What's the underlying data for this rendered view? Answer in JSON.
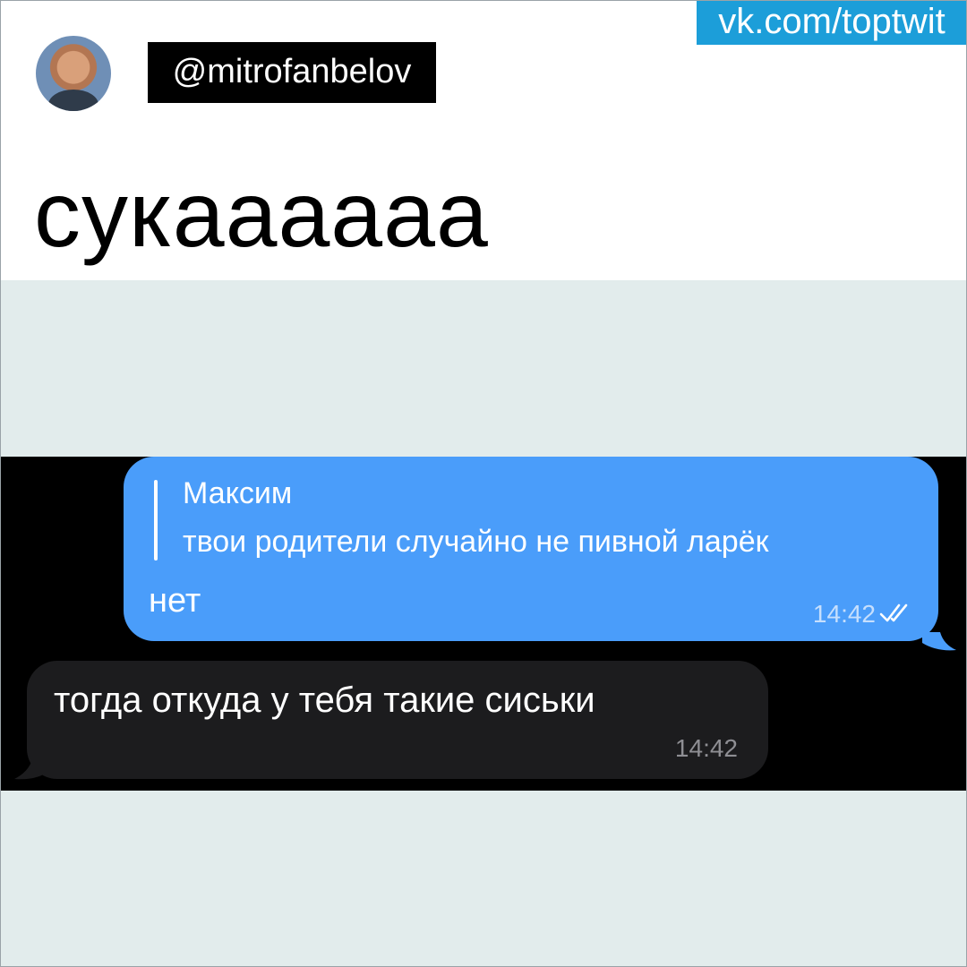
{
  "header": {
    "source": "vk.com/toptwit",
    "handle": "@mitrofanbelov",
    "avatar_icon": "user-avatar",
    "tweet_text": "сукаааааа"
  },
  "chat": {
    "outgoing": {
      "reply_name": "Максим",
      "reply_text": "твои родители случайно не пивной ларёк",
      "text": "нет",
      "time": "14:42",
      "status_icon": "double-check-icon"
    },
    "incoming": {
      "text": "тогда откуда у тебя такие сиськи",
      "time": "14:42"
    }
  },
  "colors": {
    "source_tag": "#1c9ed9",
    "outgoing_bubble": "#4a9dfa",
    "incoming_bubble": "#1c1c1e",
    "media_background": "#e2ecec",
    "chat_background": "#000000"
  }
}
